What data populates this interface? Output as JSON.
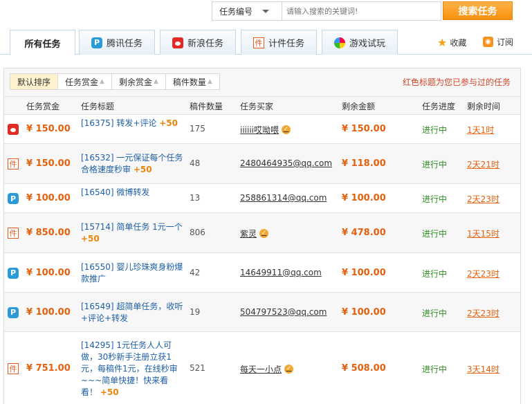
{
  "search": {
    "category": "任务编号",
    "placeholder": "请输入搜索的关键词!",
    "button": "搜索任务"
  },
  "tabs": [
    {
      "label": "所有任务",
      "icon": ""
    },
    {
      "label": "腾讯任务",
      "icon": "qq-icon"
    },
    {
      "label": "新浪任务",
      "icon": "weibo-icon"
    },
    {
      "label": "计件任务",
      "icon": "jian-icon"
    },
    {
      "label": "游戏试玩",
      "icon": "game-icon"
    }
  ],
  "actions": {
    "favorite": "收藏",
    "subscribe": "订阅"
  },
  "sort": [
    "默认排序",
    "任务赏金",
    "剩余赏金",
    "稿件数量"
  ],
  "hint": "红色标题为您已参与过的任务",
  "columns": [
    "任务赏金",
    "任务标题",
    "稿件数量",
    "任务买家",
    "剩余金额",
    "任务进度",
    "剩余时间"
  ],
  "rows": [
    {
      "source": "weibo",
      "reward": "¥ 150.00",
      "title": "[16375] 转发+评论",
      "plus": "+50",
      "count": "175",
      "buyer": "iiiiii哎呦喂",
      "verified": true,
      "remain": "¥ 150.00",
      "progress": "进行中",
      "time": "1天1时"
    },
    {
      "source": "jian",
      "reward": "¥ 150.00",
      "title": "[16532] 一元保证每个任务合格速度秒审",
      "plus": "+50",
      "count": "48",
      "buyer": "2480464935@qq.com",
      "verified": false,
      "remain": "¥ 118.00",
      "progress": "进行中",
      "time": "2天21时"
    },
    {
      "source": "qq",
      "reward": "¥ 100.00",
      "title": "[16540] 微博转发",
      "plus": "",
      "count": "13",
      "buyer": "258861314@qq.com",
      "verified": false,
      "remain": "¥ 100.00",
      "progress": "进行中",
      "time": "2天23时"
    },
    {
      "source": "jian",
      "reward": "¥ 850.00",
      "title": "[15714] 简单任务 1元一个",
      "plus": "+50",
      "count": "806",
      "buyer": "紫灵",
      "verified": true,
      "remain": "¥ 478.00",
      "progress": "进行中",
      "time": "1天15时"
    },
    {
      "source": "qq",
      "reward": "¥ 100.00",
      "title": "[16550] 婴儿珍珠爽身粉爆款推广",
      "plus": "",
      "count": "42",
      "buyer": "14649911@qq.com",
      "verified": false,
      "remain": "¥ 100.00",
      "progress": "进行中",
      "time": "2天23时"
    },
    {
      "source": "qq",
      "reward": "¥ 100.00",
      "title": "[16549] 超简单任务，收听+评论+转发",
      "plus": "",
      "count": "19",
      "buyer": "504797523@qq.com",
      "verified": false,
      "remain": "¥ 100.00",
      "progress": "进行中",
      "time": "2天23时"
    },
    {
      "source": "jian",
      "reward": "¥ 751.00",
      "title": "[14295] 1元任务人人可做，30秒新手注册立获1元，每稿件1元，在线秒审~~~简单快捷！快来看看！",
      "plus": "+50",
      "count": "521",
      "buyer": "每天一小点",
      "verified": true,
      "remain": "¥ 508.00",
      "progress": "进行中",
      "time": "3天14时"
    }
  ]
}
